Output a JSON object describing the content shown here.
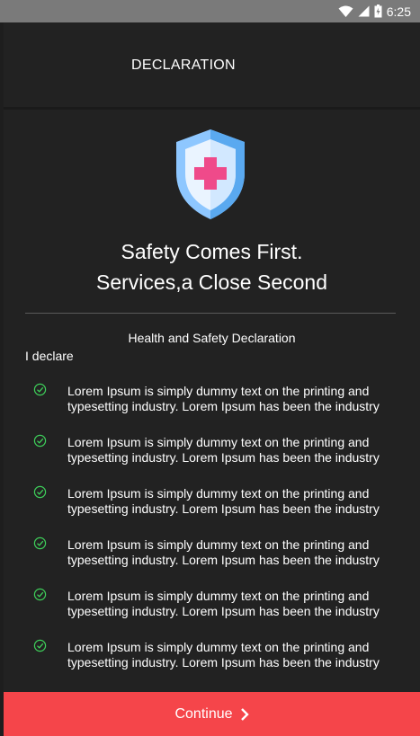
{
  "status_bar": {
    "time": "6:25",
    "icons": [
      "wifi-icon",
      "signal-icon",
      "battery-icon"
    ]
  },
  "app_bar": {
    "title": "DECLARATION"
  },
  "hero": {
    "icon": "shield-plus-icon",
    "headline_line1": "Safety Comes First.",
    "headline_line2": "Services,a Close Second"
  },
  "declaration": {
    "title": "Health and Safety Declaration",
    "intro": "I declare",
    "items": [
      {
        "line1": "Lorem Ipsum is simply dummy text on the printing and",
        "line2": "typesetting industry. Lorem Ipsum has been the industry"
      },
      {
        "line1": "Lorem Ipsum is simply dummy text on the printing and",
        "line2": "typesetting industry. Lorem Ipsum has been the industry"
      },
      {
        "line1": "Lorem Ipsum is simply dummy text on the printing and",
        "line2": "typesetting industry. Lorem Ipsum has been the industry"
      },
      {
        "line1": "Lorem Ipsum is simply dummy text on the printing and",
        "line2": "typesetting industry. Lorem Ipsum has been the industry"
      },
      {
        "line1": "Lorem Ipsum is simply dummy text on the printing and",
        "line2": "typesetting industry. Lorem Ipsum has been the industry"
      },
      {
        "line1": "Lorem Ipsum is simply dummy text on the printing and",
        "line2": "typesetting industry. Lorem Ipsum has been the industry"
      }
    ]
  },
  "footer": {
    "continue_label": "Continue",
    "continue_icon": "chevron-right-icon"
  },
  "colors": {
    "background": "#222222",
    "accent": "#f5454a",
    "check": "#3ecf5a",
    "shield_light": "#b9dcff",
    "shield_dark": "#5aa9f0",
    "cross": "#ef4a8a"
  }
}
